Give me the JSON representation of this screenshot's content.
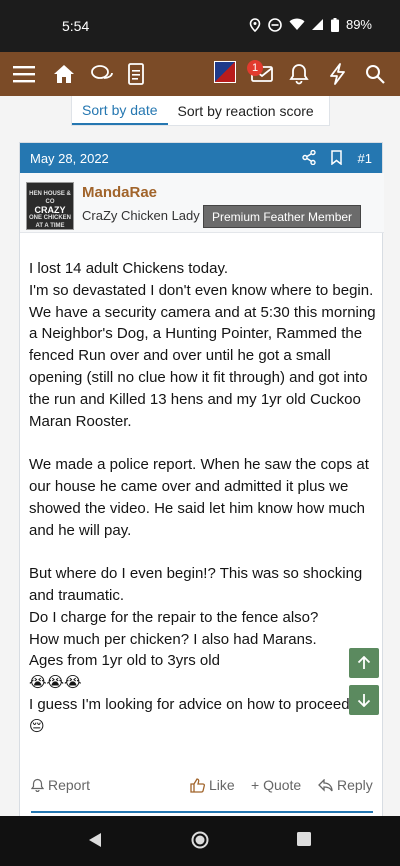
{
  "status_bar": {
    "time": "5:54",
    "battery": "89%",
    "icons": [
      "location-icon",
      "dnd-icon",
      "wifi-icon",
      "signal-icon",
      "battery-icon"
    ]
  },
  "app_bar": {
    "icons": [
      "menu-icon",
      "home-icon",
      "chat-icon",
      "document-icon",
      "avatar",
      "inbox-icon",
      "bell-icon",
      "lightning-icon",
      "search-icon"
    ],
    "inbox_badge": "1",
    "background": "#7b4b27"
  },
  "sort": {
    "by_date": "Sort by date",
    "by_reaction": "Sort by reaction score"
  },
  "post": {
    "date": "May 28, 2022",
    "number": "#1",
    "user": {
      "name": "MandaRae",
      "title": "CraZy Chicken Lady",
      "banner": "Premium Feather Member",
      "avatar_text_top": "HEN HOUSE & CO",
      "avatar_text_main": "CRAZY",
      "avatar_text_bottom": "ONE CHICKEN AT A TIME"
    },
    "body": [
      "I lost 14 adult Chickens today.",
      "I'm so devastated I don't even know where to begin.",
      "We have a security camera and at 5:30 this morning a Neighbor's Dog, a Hunting Pointer, Rammed the fenced Run over and over until he got a small opening (still no clue how it fit through) and got into the run and Killed 13 hens and my 1yr old Cuckoo Maran Rooster.",
      "",
      "We made a police report. When he saw the cops at our house he came over and admitted it plus we showed the video. He said let him know how much and he will pay.",
      "",
      "But where do I even begin!? This was so shocking and traumatic.",
      "Do I charge for the repair to the fence also?",
      "How much per chicken? I also had Marans.",
      "Ages from 1yr old to 3yrs old",
      "😭😭😭",
      "I guess I'm looking for advice on how to proceed.",
      "😔"
    ],
    "actions": {
      "report": "Report",
      "like": "Like",
      "quote": "+ Quote",
      "reply": "Reply"
    }
  },
  "colors": {
    "accent": "#2577b1",
    "username": "#a1642b",
    "scroll_button": "#5b8a5f"
  }
}
